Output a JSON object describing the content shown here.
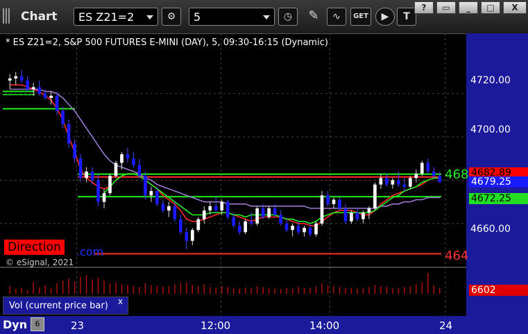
{
  "toolbar": {
    "window_title": "Chart",
    "symbol": "ES Z21=2",
    "interval": "5",
    "get_label": "GET",
    "window_buttons": [
      "?",
      "▭",
      "_",
      "□",
      "X"
    ]
  },
  "chart_header": "* ES Z21=2, S&P 500 FUTURES E-MINI (DAY), 5, 09:30-16:15 (Dynamic)",
  "watermark": {
    "direction": "Direction",
    "dotcom": ".com",
    "copyright": "© eSignal, 2021"
  },
  "price_tags": {
    "red_line": "4682.89",
    "last": "4679.25",
    "green_ma": "4672.25",
    "green_clipped": "468",
    "red_clipped": "464",
    "volume": "6602"
  },
  "volume_pane": {
    "label": "Vol (current price bar)",
    "close_icon": "x"
  },
  "bottom": {
    "dyn_label": "Dyn",
    "dyn_button": "6"
  },
  "colors": {
    "background": "#000000",
    "axis_panel": "#1a1a9a",
    "up_candle": "#ffffff",
    "down_candle": "#1a1aff",
    "red": "#ff2a2a",
    "green": "#22ee22",
    "violet": "#9a7ad0"
  },
  "chart_data": {
    "type": "candlestick",
    "title": "* ES Z21=2, S&P 500 FUTURES E-MINI (DAY), 5, 09:30-16:15 (Dynamic)",
    "y_ticks": [
      4660,
      4680,
      4700,
      4720
    ],
    "y_tick_labels": [
      "4660.00",
      "",
      "4700.00",
      "4720.00"
    ],
    "ylim": [
      4642,
      4735
    ],
    "x_tick_labels": [
      "23",
      "12:00",
      "14:00",
      "24"
    ],
    "grid": true,
    "horizontal_lines": [
      {
        "name": "red-line",
        "value": 4681.5,
        "color": "#ff2a2a"
      },
      {
        "name": "green-line-upper",
        "value": 4682.8,
        "color": "#22ee22"
      },
      {
        "name": "green-line-lower",
        "value": 4672.4,
        "color": "#22ee22"
      },
      {
        "name": "red-line-lower",
        "value": 4646,
        "color": "#ff2a2a"
      }
    ],
    "candles": [
      {
        "o": 4726,
        "h": 4729,
        "l": 4722,
        "c": 4727
      },
      {
        "o": 4727,
        "h": 4730,
        "l": 4724,
        "c": 4728
      },
      {
        "o": 4728,
        "h": 4731,
        "l": 4725,
        "c": 4726
      },
      {
        "o": 4726,
        "h": 4728,
        "l": 4721,
        "c": 4722
      },
      {
        "o": 4722,
        "h": 4725,
        "l": 4719,
        "c": 4723
      },
      {
        "o": 4723,
        "h": 4726,
        "l": 4719,
        "c": 4720
      },
      {
        "o": 4720,
        "h": 4722,
        "l": 4717,
        "c": 4718
      },
      {
        "o": 4718,
        "h": 4721,
        "l": 4715,
        "c": 4719
      },
      {
        "o": 4719,
        "h": 4721,
        "l": 4710,
        "c": 4712
      },
      {
        "o": 4712,
        "h": 4714,
        "l": 4704,
        "c": 4706
      },
      {
        "o": 4706,
        "h": 4708,
        "l": 4695,
        "c": 4697
      },
      {
        "o": 4697,
        "h": 4699,
        "l": 4688,
        "c": 4690
      },
      {
        "o": 4690,
        "h": 4692,
        "l": 4679,
        "c": 4681
      },
      {
        "o": 4681,
        "h": 4686,
        "l": 4679,
        "c": 4684
      },
      {
        "o": 4684,
        "h": 4686,
        "l": 4678,
        "c": 4680
      },
      {
        "o": 4680,
        "h": 4683,
        "l": 4668,
        "c": 4670
      },
      {
        "o": 4670,
        "h": 4676,
        "l": 4667,
        "c": 4674
      },
      {
        "o": 4674,
        "h": 4683,
        "l": 4673,
        "c": 4682
      },
      {
        "o": 4682,
        "h": 4689,
        "l": 4681,
        "c": 4688
      },
      {
        "o": 4688,
        "h": 4693,
        "l": 4685,
        "c": 4692
      },
      {
        "o": 4692,
        "h": 4695,
        "l": 4688,
        "c": 4690
      },
      {
        "o": 4690,
        "h": 4693,
        "l": 4686,
        "c": 4687
      },
      {
        "o": 4687,
        "h": 4690,
        "l": 4681,
        "c": 4682
      },
      {
        "o": 4682,
        "h": 4684,
        "l": 4671,
        "c": 4673
      },
      {
        "o": 4673,
        "h": 4677,
        "l": 4670,
        "c": 4675
      },
      {
        "o": 4675,
        "h": 4677,
        "l": 4668,
        "c": 4669
      },
      {
        "o": 4669,
        "h": 4671,
        "l": 4665,
        "c": 4666
      },
      {
        "o": 4666,
        "h": 4670,
        "l": 4663,
        "c": 4668
      },
      {
        "o": 4668,
        "h": 4670,
        "l": 4661,
        "c": 4662
      },
      {
        "o": 4662,
        "h": 4664,
        "l": 4655,
        "c": 4656
      },
      {
        "o": 4656,
        "h": 4658,
        "l": 4648,
        "c": 4652
      },
      {
        "o": 4652,
        "h": 4658,
        "l": 4650,
        "c": 4657
      },
      {
        "o": 4657,
        "h": 4663,
        "l": 4656,
        "c": 4662
      },
      {
        "o": 4662,
        "h": 4668,
        "l": 4660,
        "c": 4666
      },
      {
        "o": 4666,
        "h": 4670,
        "l": 4664,
        "c": 4668
      },
      {
        "o": 4668,
        "h": 4672,
        "l": 4665,
        "c": 4666
      },
      {
        "o": 4666,
        "h": 4671,
        "l": 4664,
        "c": 4670
      },
      {
        "o": 4670,
        "h": 4671,
        "l": 4662,
        "c": 4663
      },
      {
        "o": 4663,
        "h": 4665,
        "l": 4658,
        "c": 4659
      },
      {
        "o": 4659,
        "h": 4661,
        "l": 4655,
        "c": 4656
      },
      {
        "o": 4656,
        "h": 4662,
        "l": 4655,
        "c": 4661
      },
      {
        "o": 4661,
        "h": 4665,
        "l": 4659,
        "c": 4660
      },
      {
        "o": 4660,
        "h": 4668,
        "l": 4659,
        "c": 4667
      },
      {
        "o": 4667,
        "h": 4669,
        "l": 4662,
        "c": 4663
      },
      {
        "o": 4663,
        "h": 4668,
        "l": 4662,
        "c": 4667
      },
      {
        "o": 4667,
        "h": 4669,
        "l": 4663,
        "c": 4664
      },
      {
        "o": 4664,
        "h": 4666,
        "l": 4659,
        "c": 4660
      },
      {
        "o": 4660,
        "h": 4662,
        "l": 4656,
        "c": 4657
      },
      {
        "o": 4657,
        "h": 4660,
        "l": 4654,
        "c": 4659
      },
      {
        "o": 4659,
        "h": 4661,
        "l": 4655,
        "c": 4656
      },
      {
        "o": 4656,
        "h": 4659,
        "l": 4654,
        "c": 4658
      },
      {
        "o": 4658,
        "h": 4660,
        "l": 4654,
        "c": 4655
      },
      {
        "o": 4655,
        "h": 4661,
        "l": 4654,
        "c": 4660
      },
      {
        "o": 4660,
        "h": 4675,
        "l": 4659,
        "c": 4673
      },
      {
        "o": 4673,
        "h": 4675,
        "l": 4668,
        "c": 4669
      },
      {
        "o": 4669,
        "h": 4672,
        "l": 4667,
        "c": 4671
      },
      {
        "o": 4671,
        "h": 4672,
        "l": 4666,
        "c": 4667
      },
      {
        "o": 4667,
        "h": 4669,
        "l": 4660,
        "c": 4661
      },
      {
        "o": 4661,
        "h": 4666,
        "l": 4660,
        "c": 4665
      },
      {
        "o": 4665,
        "h": 4667,
        "l": 4661,
        "c": 4662
      },
      {
        "o": 4662,
        "h": 4666,
        "l": 4660,
        "c": 4665
      },
      {
        "o": 4665,
        "h": 4668,
        "l": 4662,
        "c": 4667
      },
      {
        "o": 4667,
        "h": 4679,
        "l": 4666,
        "c": 4678
      },
      {
        "o": 4678,
        "h": 4683,
        "l": 4676,
        "c": 4681
      },
      {
        "o": 4681,
        "h": 4683,
        "l": 4677,
        "c": 4678
      },
      {
        "o": 4678,
        "h": 4681,
        "l": 4676,
        "c": 4680
      },
      {
        "o": 4680,
        "h": 4684,
        "l": 4677,
        "c": 4678
      },
      {
        "o": 4678,
        "h": 4681,
        "l": 4675,
        "c": 4677
      },
      {
        "o": 4677,
        "h": 4682,
        "l": 4676,
        "c": 4681
      },
      {
        "o": 4681,
        "h": 4685,
        "l": 4679,
        "c": 4683
      },
      {
        "o": 4683,
        "h": 4689,
        "l": 4682,
        "c": 4688
      },
      {
        "o": 4688,
        "h": 4690,
        "l": 4683,
        "c": 4684
      },
      {
        "o": 4684,
        "h": 4686,
        "l": 4681,
        "c": 4682
      },
      {
        "o": 4682,
        "h": 4684,
        "l": 4679,
        "c": 4679
      }
    ],
    "moving_averages": [
      {
        "color": "red",
        "values": [
          4724,
          4724,
          4724,
          4723,
          4722,
          4721,
          4719,
          4717,
          4713,
          4708,
          4700,
          4693,
          4685,
          4681,
          4679,
          4677,
          4676,
          4677,
          4680,
          4682,
          4683,
          4683,
          4682,
          4680,
          4678,
          4676,
          4673,
          4671,
          4669,
          4666,
          4662,
          4661,
          4661,
          4662,
          4663,
          4664,
          4665,
          4665,
          4664,
          4663,
          4662,
          4661,
          4662,
          4663,
          4663,
          4663,
          4663,
          4662,
          4661,
          4660,
          4660,
          4659,
          4659,
          4661,
          4663,
          4665,
          4666,
          4666,
          4666,
          4665,
          4664,
          4664,
          4666,
          4669,
          4671,
          4673,
          4674,
          4675,
          4676,
          4677,
          4678,
          4680,
          4681,
          4681
        ]
      },
      {
        "color": "violet",
        "values": [
          4722,
          4722,
          4722,
          4722,
          4722,
          4722,
          4721,
          4721,
          4720,
          4718,
          4715,
          4712,
          4708,
          4704,
          4700,
          4696,
          4692,
          4689,
          4687,
          4686,
          4685,
          4684,
          4683,
          4681,
          4680,
          4678,
          4677,
          4676,
          4675,
          4674,
          4673,
          4672,
          4671,
          4670,
          4670,
          4670,
          4670,
          4669,
          4669,
          4669,
          4669,
          4668,
          4668,
          4668,
          4668,
          4668,
          4668,
          4668,
          4668,
          4668,
          4668,
          4667,
          4667,
          4667,
          4667,
          4667,
          4667,
          4667,
          4667,
          4667,
          4667,
          4667,
          4667,
          4668,
          4668,
          4669,
          4669,
          4670,
          4670,
          4671,
          4671,
          4672,
          4672,
          4672
        ]
      },
      {
        "color": "green",
        "values": [
          null,
          null,
          null,
          null,
          null,
          null,
          null,
          null,
          null,
          null,
          null,
          null,
          null,
          null,
          null,
          null,
          4674,
          4677,
          4680,
          4682,
          4683,
          4683,
          4682,
          4680,
          4678,
          4676,
          4674,
          4672,
          4670,
          4668,
          4666,
          4664,
          4664,
          4664,
          4665,
          4665,
          4665,
          4665,
          4664,
          4664,
          4663,
          4664,
          4664,
          4664,
          4664,
          4664,
          4663,
          4662,
          4662,
          4661,
          4661,
          4660,
          4661,
          4663,
          4664,
          4665,
          4665,
          4665,
          4665,
          4665,
          4665,
          4665,
          4666,
          4668,
          4670,
          4672,
          4673,
          4675,
          4676,
          4677,
          4679,
          4680,
          4681,
          4681
        ]
      }
    ],
    "volume": [
      40,
      25,
      30,
      20,
      60,
      35,
      45,
      30,
      55,
      70,
      80,
      65,
      90,
      100,
      75,
      85,
      70,
      55,
      60,
      50,
      45,
      40,
      35,
      55,
      45,
      40,
      38,
      42,
      50,
      55,
      60,
      45,
      40,
      50,
      35,
      30,
      40,
      35,
      30,
      28,
      32,
      30,
      40,
      35,
      30,
      28,
      25,
      30,
      28,
      35,
      30,
      32,
      38,
      55,
      45,
      40,
      35,
      30,
      32,
      28,
      30,
      35,
      45,
      40,
      38,
      30,
      32,
      36,
      40,
      50,
      60,
      110,
      45,
      30
    ]
  }
}
